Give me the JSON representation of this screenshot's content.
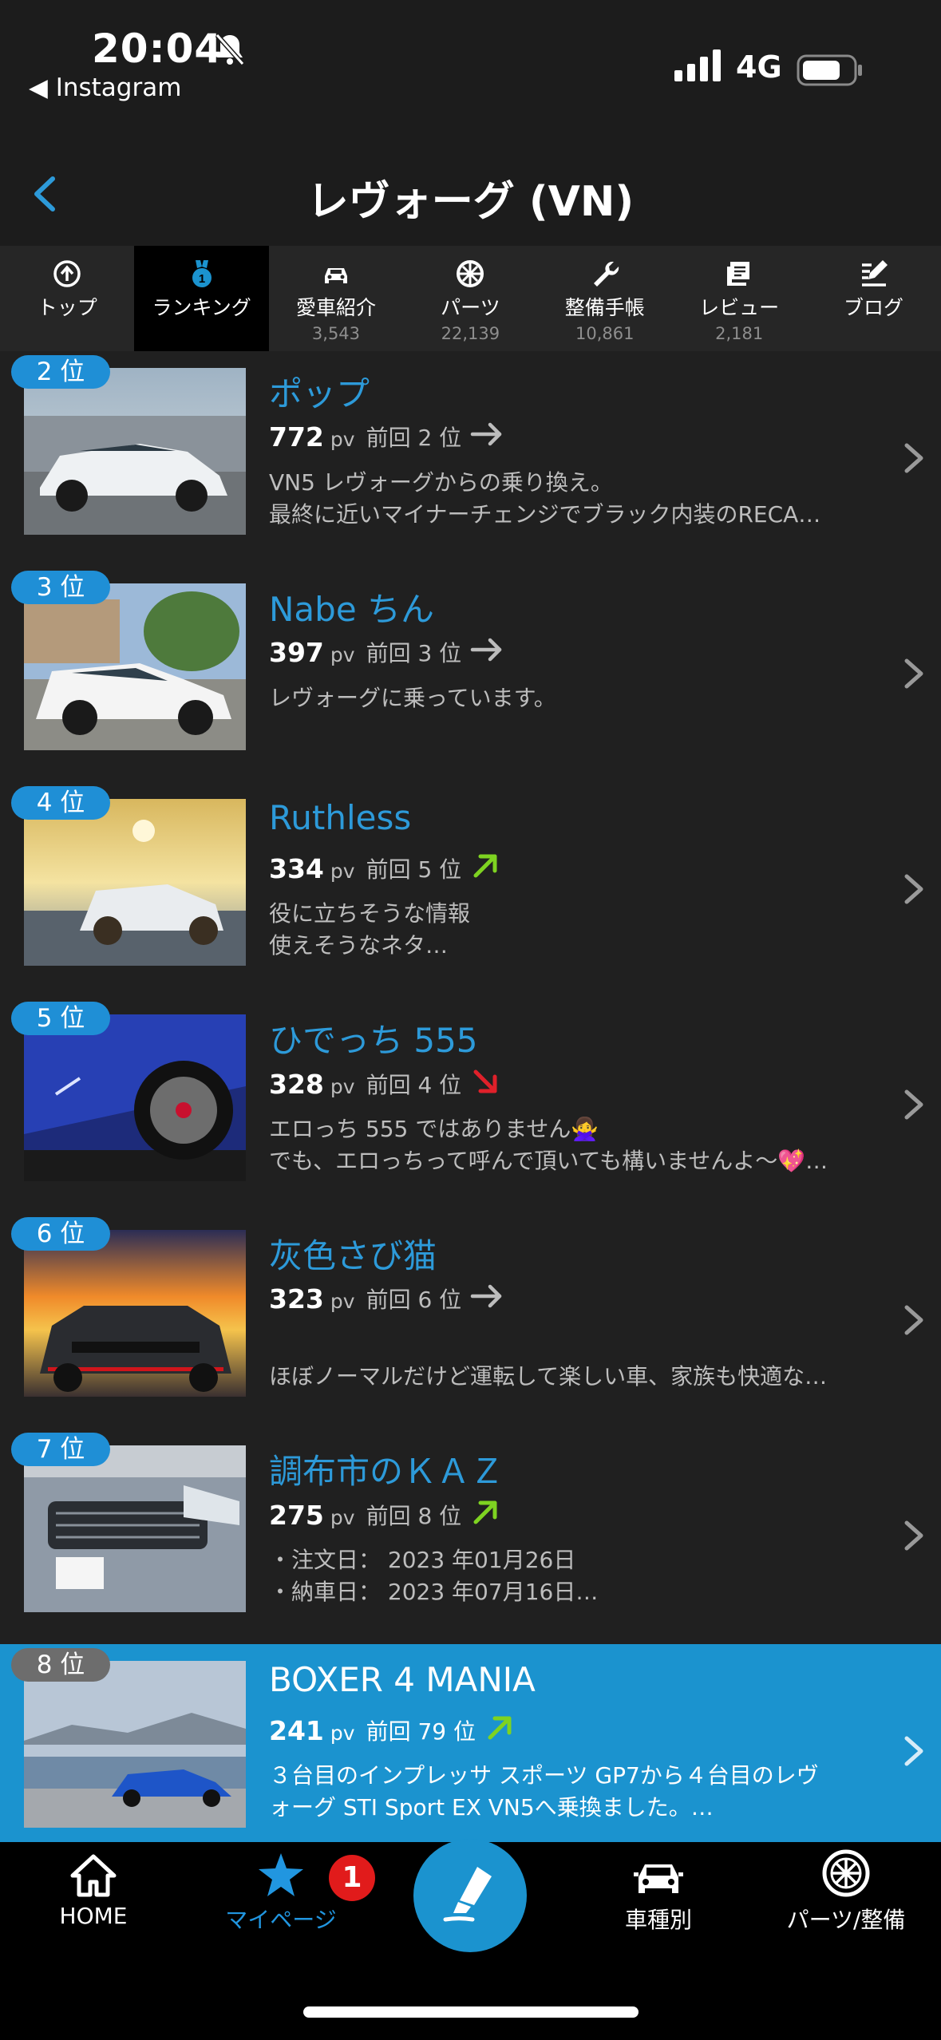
{
  "status_bar": {
    "time": "20:04",
    "back_app": "◀ Instagram",
    "network": "4G"
  },
  "header": {
    "title": "レヴォーグ (VN)"
  },
  "tabs": [
    {
      "label": "トップ",
      "count": "",
      "icon": "top-circle-icon"
    },
    {
      "label": "ランキング",
      "count": "",
      "icon": "medal-icon"
    },
    {
      "label": "愛車紹介",
      "count": "3,543",
      "icon": "car-icon"
    },
    {
      "label": "パーツ",
      "count": "22,139",
      "icon": "wheel-icon"
    },
    {
      "label": "整備手帳",
      "count": "10,861",
      "icon": "wrench-icon"
    },
    {
      "label": "レビュー",
      "count": "2,181",
      "icon": "review-icon"
    },
    {
      "label": "ブログ",
      "count": "",
      "icon": "blog-icon"
    }
  ],
  "rankings": [
    {
      "rank": "2 位",
      "name": "ポップ",
      "pv": "772",
      "pv_unit": "pv",
      "previous": "前回 2 位",
      "trend": "same",
      "desc": [
        "VN5 レヴォーグからの乗り換え。",
        "最終に近いマイナーチェンジでブラック内装のRECA…"
      ]
    },
    {
      "rank": "3 位",
      "name": "Nabe ちん",
      "pv": "397",
      "pv_unit": "pv",
      "previous": "前回 3 位",
      "trend": "same",
      "desc": [
        "レヴォーグに乗っています。",
        ""
      ]
    },
    {
      "rank": "4 位",
      "name": "Ruthless",
      "pv": "334",
      "pv_unit": "pv",
      "previous": "前回 5 位",
      "trend": "up",
      "desc": [
        "役に立ちそうな情報",
        "使えそうなネタ…"
      ]
    },
    {
      "rank": "5 位",
      "name": "ひでっち 555",
      "pv": "328",
      "pv_unit": "pv",
      "previous": "前回 4 位",
      "trend": "down",
      "desc": [
        "エロっち 555 ではありません🙅‍♀️",
        "でも、エロっちって呼んで頂いても構いませんよ〜💖…"
      ]
    },
    {
      "rank": "6 位",
      "name": "灰色さび猫",
      "pv": "323",
      "pv_unit": "pv",
      "previous": "前回 6 位",
      "trend": "same",
      "desc": [
        "",
        "ほぼノーマルだけど運転して楽しい車、家族も快適な…"
      ]
    },
    {
      "rank": "7 位",
      "name": "調布市のＫＡＺ",
      "pv": "275",
      "pv_unit": "pv",
      "previous": "前回 8 位",
      "trend": "up",
      "desc": [
        "・注文日： 2023 年01月26日",
        "・納車日： 2023 年07月16日…"
      ]
    },
    {
      "rank": "8 位",
      "name": "BOXER 4 MANIA",
      "pv": "241",
      "pv_unit": "pv",
      "previous": "前回 79 位",
      "trend": "up",
      "desc": [
        "３台目のインプレッサ スポーツ GP7から４台目のレヴ",
        "ォーグ  STI  Sport  EX  VN5へ乗換ました。…"
      ]
    }
  ],
  "tabbar": {
    "home": "HOME",
    "mypage": "マイページ",
    "mypage_badge": "1",
    "car_type": "車種別",
    "parts": "パーツ/整備"
  },
  "colors": {
    "accent": "#1b93cf",
    "link": "#2d9ad9",
    "up": "#7ed321",
    "down": "#e0202a",
    "badge": "#e11b1b"
  }
}
